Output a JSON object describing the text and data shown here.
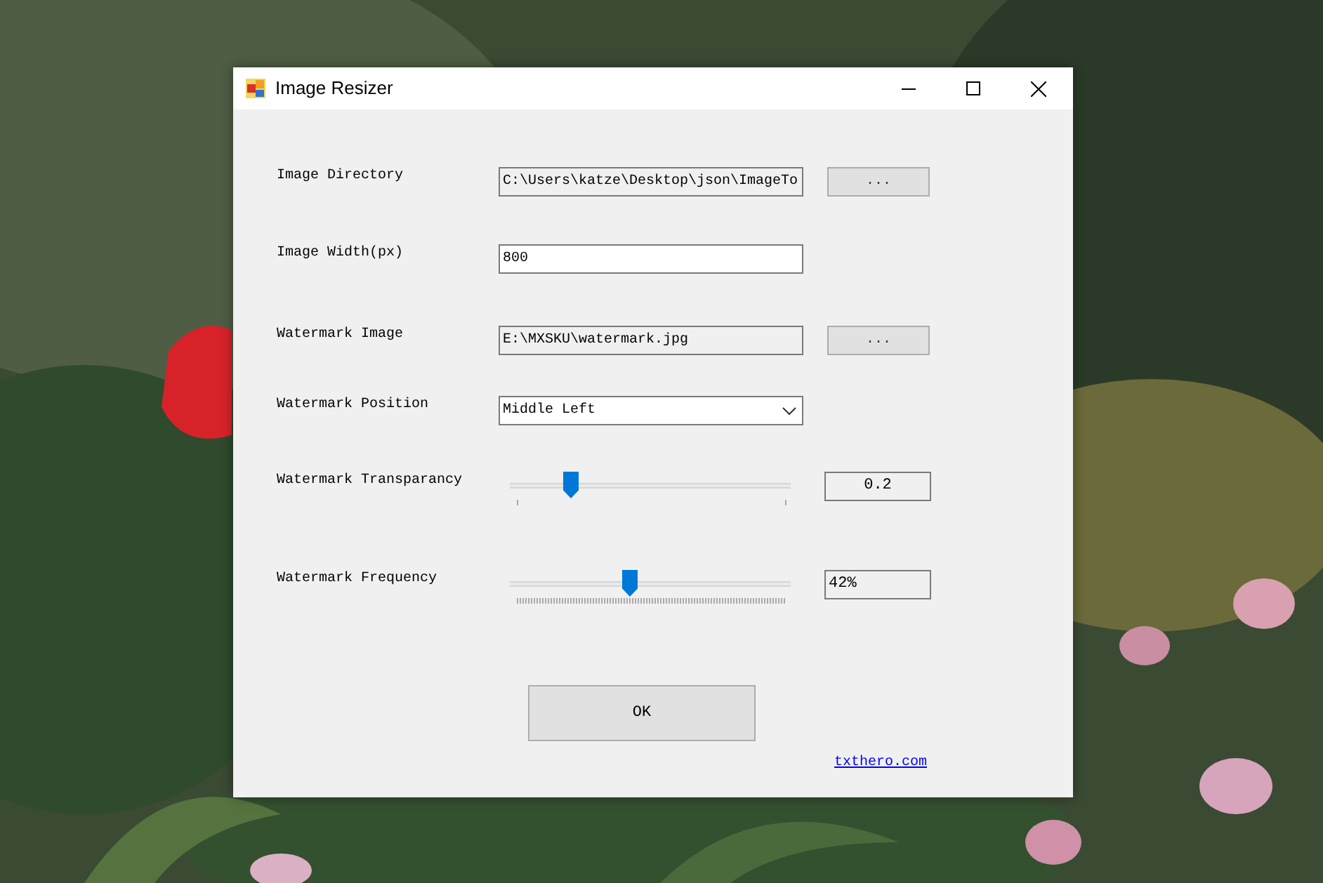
{
  "window": {
    "title": "Image Resizer"
  },
  "rows": [
    {
      "kind": "text",
      "label": "Image Directory",
      "value": "C:\\Users\\katze\\Desktop\\json\\ImageTo",
      "readonly": true,
      "button": "..."
    },
    {
      "kind": "text",
      "label": "Image Width(px)",
      "value": "800",
      "readonly": false
    },
    {
      "kind": "text",
      "label": "Watermark Image",
      "value": "E:\\MXSKU\\watermark.jpg",
      "readonly": true,
      "button": "..."
    },
    {
      "kind": "dropdown",
      "label": "Watermark Position",
      "value": "Middle Left"
    },
    {
      "kind": "slider",
      "fine_ticks": false,
      "label": "Watermark Transparancy",
      "level": 0.215,
      "reading": "0.2"
    },
    {
      "kind": "slider",
      "fine_ticks": true,
      "label": "Watermark Frequency",
      "level": 0.425,
      "reading": "42%"
    }
  ],
  "ok_button": "OK",
  "link": "txthero.com"
}
